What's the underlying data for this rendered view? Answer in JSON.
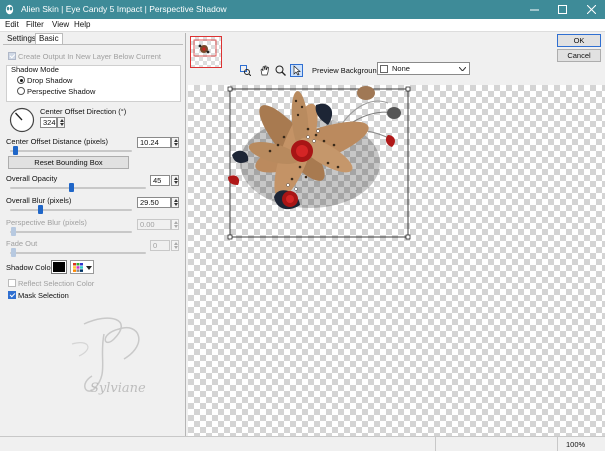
{
  "window": {
    "title": "Alien Skin | Eye Candy 5 Impact | Perspective Shadow"
  },
  "menu": {
    "items": [
      "Edit",
      "Filter",
      "View",
      "Help"
    ]
  },
  "tabs": {
    "settings": "Settings",
    "basic": "Basic"
  },
  "basic": {
    "create_output_label": "Create Output In New Layer Below Current",
    "shadow_mode_label": "Shadow Mode",
    "drop_shadow_label": "Drop Shadow",
    "perspective_shadow_label": "Perspective Shadow",
    "center_offset_direction_label": "Center Offset Direction (°)",
    "center_offset_direction_value": "324",
    "center_offset_distance_label": "Center Offset Distance (pixels)",
    "center_offset_distance_value": "10.24",
    "reset_bounding_box_label": "Reset Bounding Box",
    "overall_opacity_label": "Overall Opacity",
    "overall_opacity_value": "45",
    "overall_blur_label": "Overall Blur (pixels)",
    "overall_blur_value": "29.50",
    "perspective_blur_label": "Perspective Blur (pixels)",
    "perspective_blur_value": "0.00",
    "fade_out_label": "Fade Out",
    "fade_out_value": "0",
    "shadow_color_label": "Shadow Color",
    "reflect_selection_color_label": "Reflect Selection Color",
    "mask_selection_label": "Mask Selection"
  },
  "watermark": {
    "text": "Sylviane"
  },
  "preview": {
    "background_label": "Preview Background:",
    "background_value": "None"
  },
  "buttons": {
    "ok": "OK",
    "cancel": "Cancel"
  },
  "status": {
    "zoom": "100%"
  },
  "colors": {
    "titlebar": "#3e8b98",
    "accent": "#2f6fd1",
    "shadow_color": "#000000"
  }
}
